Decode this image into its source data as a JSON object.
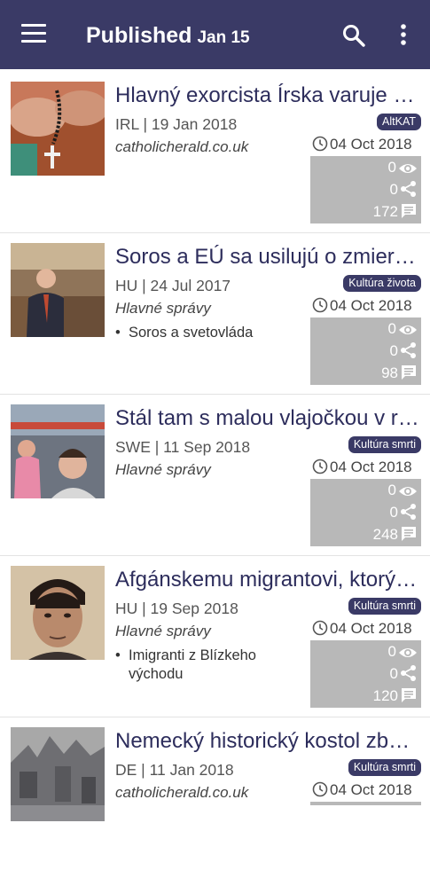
{
  "header": {
    "title": "Published",
    "date": "Jan 15"
  },
  "articles": [
    {
      "headline": "Hlavný exorcista Írska varuje pred...",
      "meta": "IRL | 19 Jan 2018",
      "source": "catholicherald.co.uk",
      "bullet": "",
      "category": "AltKAT",
      "date": "04 Oct 2018",
      "views": "0",
      "shares": "0",
      "comments": "172"
    },
    {
      "headline": "Soros a EÚ sa usilujú o zmiernenie...",
      "meta": "HU | 24 Jul 2017",
      "source": "Hlavné správy",
      "bullet": "Soros a svetovláda",
      "category": "Kultúra života",
      "date": "04 Oct 2018",
      "views": "0",
      "shares": "0",
      "comments": "98"
    },
    {
      "headline": "Stál tam s malou vlajočkou v ruke",
      "meta": "SWE | 11 Sep 2018",
      "source": "Hlavné správy",
      "bullet": "",
      "category": "Kultúra smrti",
      "date": "04 Oct 2018",
      "views": "0",
      "shares": "0",
      "comments": "248"
    },
    {
      "headline": "Afgánskemu migrantovi, ktorý znásilnil...",
      "meta": "HU | 19 Sep 2018",
      "source": "Hlavné správy",
      "bullet": "Imigranti z Blízkeho východu",
      "category": "Kultúra smrti",
      "date": "04 Oct 2018",
      "views": "0",
      "shares": "0",
      "comments": "120"
    },
    {
      "headline": "Nemecký historický kostol zbúrali",
      "meta": "DE | 11 Jan 2018",
      "source": "catholicherald.co.uk",
      "bullet": "",
      "category": "Kultúra smrti",
      "date": "04 Oct 2018",
      "views": "",
      "shares": "",
      "comments": ""
    }
  ],
  "icons": {
    "menu": "hamburger-menu-icon",
    "search": "search-icon",
    "more": "more-vert-icon",
    "clock": "clock-icon",
    "views": "eye-icon",
    "shares": "share-icon",
    "comments": "comment-icon"
  },
  "colors": {
    "appbar": "#3a3a66",
    "headline": "#2d2d5c",
    "badge": "#3a3a66",
    "stats_bg": "#b8b8b8"
  }
}
